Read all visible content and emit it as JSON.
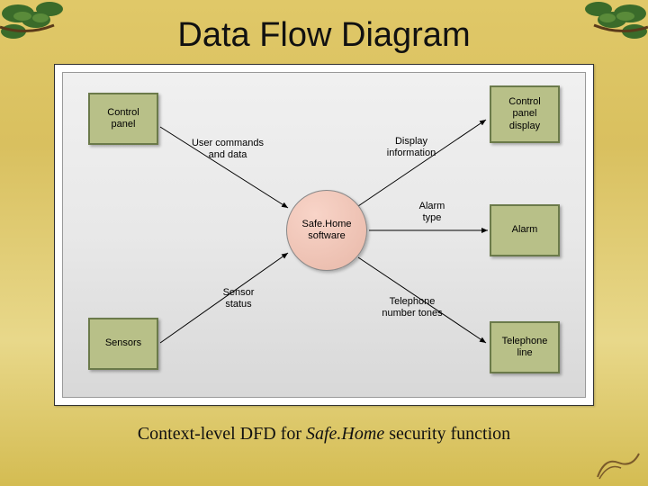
{
  "title": "Data Flow Diagram",
  "caption": {
    "prefix": "Context-level DFD for ",
    "italic": "Safe.Home",
    "suffix": " security function"
  },
  "process": {
    "label": "Safe.Home\nsoftware"
  },
  "entities": {
    "control_panel": "Control\npanel",
    "sensors": "Sensors",
    "control_panel_display": "Control\npanel\ndisplay",
    "alarm": "Alarm",
    "telephone_line": "Telephone\nline"
  },
  "flows": {
    "user_commands": "User commands\nand data",
    "sensor_status": "Sensor\nstatus",
    "display_info": "Display\ninformation",
    "alarm_type": "Alarm\ntype",
    "telephone_tones": "Telephone\nnumber tones"
  },
  "colors": {
    "entity_fill": "#b8c088",
    "entity_border": "#6b7a4a",
    "process_fill": "#e8b8a8"
  }
}
